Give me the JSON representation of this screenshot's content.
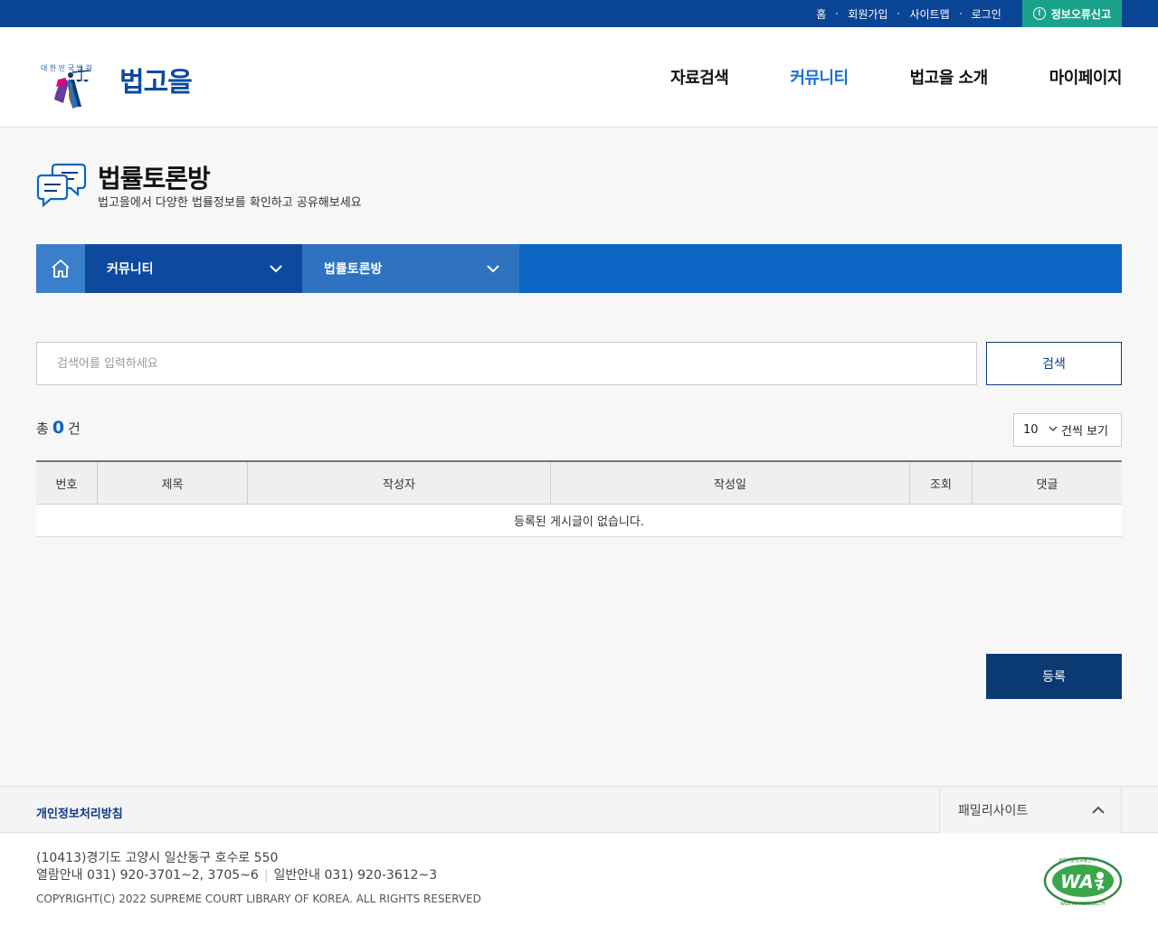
{
  "topbar": {
    "links": [
      "홈",
      "회원가입",
      "사이트맵",
      "로그인"
    ],
    "report_icon": "info-icon",
    "report_label": "정보오류신고"
  },
  "header": {
    "logo_text": "법고을",
    "logo_ring_text": "대한민국법원",
    "menu": [
      "자료검색",
      "커뮤니티",
      "법고을 소개",
      "마이페이지"
    ],
    "active_menu": "커뮤니티"
  },
  "page": {
    "title": "법률토론방",
    "subtitle": "법고을에서 다양한 법률정보를 확인하고 공유해보세요",
    "icon": "chat-bubbles-icon"
  },
  "location": {
    "home_icon": "home-icon",
    "level1": "커뮤니티",
    "level2": "법률토론방"
  },
  "search": {
    "placeholder": "검색어를 입력하세요",
    "button": "검색"
  },
  "list": {
    "total_prefix": "총",
    "total_count": "0",
    "total_suffix": "건",
    "per_page_value": "10",
    "per_page_label": "건씩 보기",
    "columns": [
      "번호",
      "제목",
      "작성자",
      "작성일",
      "조회",
      "댓글"
    ],
    "empty_message": "등록된 게시글이 없습니다."
  },
  "register_button": "등록",
  "footer": {
    "privacy": "개인정보처리방침",
    "family_site": "패밀리사이트",
    "address": "(10413)경기도 고양시 일산동구 호수로 550",
    "tel1": "열람안내 031) 920-3701~2, 3705~6",
    "tel2": "일반안내 031) 920-3612~3",
    "copyright": "COPYRIGHT(C) 2022 SUPREME COURT LIBRARY OF KOREA. ALL RIGHTS RESERVED",
    "badge_text": "WA",
    "badge_ring_top": "과학기술정보통신부",
    "badge_ring_bottom": "WEB ACCESSIBILITY"
  },
  "colors": {
    "topbar": "#0a4595",
    "report": "#1aa38a",
    "primary": "#0b65c2",
    "active_menu": "#1572d6",
    "register": "#0b3a73"
  }
}
